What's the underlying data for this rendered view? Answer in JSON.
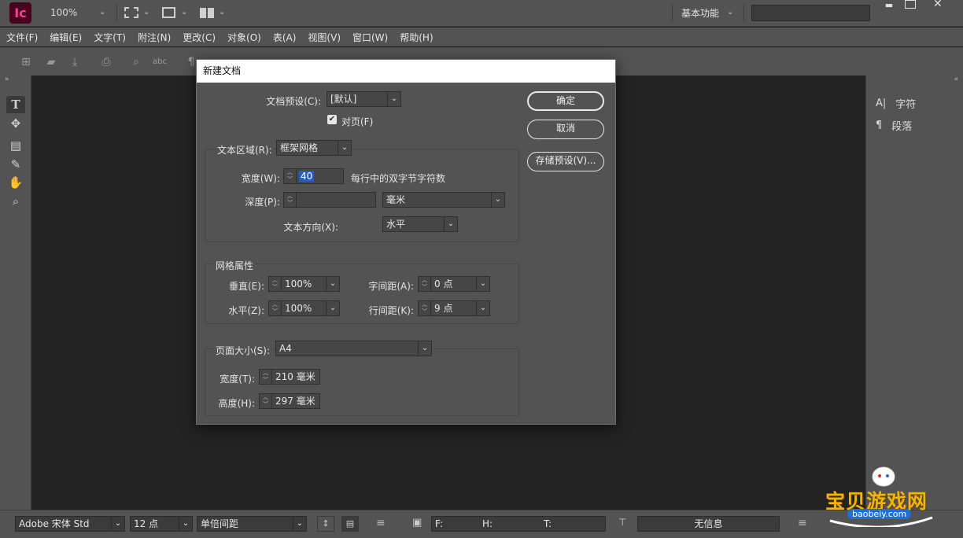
{
  "app": {
    "logo_text": "Ic",
    "zoom": "100%",
    "workspace": "基本功能"
  },
  "menu": [
    "文件(F)",
    "编辑(E)",
    "文字(T)",
    "附注(N)",
    "更改(C)",
    "对象(O)",
    "表(A)",
    "视图(V)",
    "窗口(W)",
    "帮助(H)"
  ],
  "right_panel": {
    "items": [
      {
        "icon": "A|",
        "label": "字符"
      },
      {
        "icon": "¶",
        "label": "段落"
      }
    ]
  },
  "dialog": {
    "title": "新建文档",
    "preset_label": "文档预设(C):",
    "preset_value": "[默认]",
    "facing_pages_label": "对页(F)",
    "facing_pages_checked": true,
    "ok_label": "确定",
    "cancel_label": "取消",
    "save_preset_label": "存储预设(V)...",
    "text_area": {
      "label": "文本区域(R):",
      "value": "框架网格",
      "width_label": "宽度(W):",
      "width_value": "40",
      "width_suffix": "每行中的双字节字符数",
      "depth_label": "深度(P):",
      "depth_value": "",
      "depth_unit": "毫米",
      "direction_label": "文本方向(X):",
      "direction_value": "水平"
    },
    "grid": {
      "title": "网格属性",
      "vertical_label": "垂直(E):",
      "vertical_value": "100%",
      "horizontal_label": "水平(Z):",
      "horizontal_value": "100%",
      "char_spacing_label": "字间距(A):",
      "char_spacing_value": "0 点",
      "line_spacing_label": "行间距(K):",
      "line_spacing_value": "9 点"
    },
    "page": {
      "size_label": "页面大小(S):",
      "size_value": "A4",
      "width_label": "宽度(T):",
      "width_value": "210 毫米",
      "height_label": "高度(H):",
      "height_value": "297 毫米"
    }
  },
  "statusbar": {
    "font": "Adobe 宋体 Std",
    "size": "12 点",
    "spacing": "单倍间距",
    "f_label": "F:",
    "h_label": "H:",
    "t_label": "T:",
    "info": "无信息"
  },
  "watermark": {
    "text": "宝贝游戏网",
    "url": "baobeiy.com"
  },
  "colors": {
    "accent": "#ff3f94",
    "logo_bg": "#49021f",
    "selection": "#2a5fb0"
  }
}
